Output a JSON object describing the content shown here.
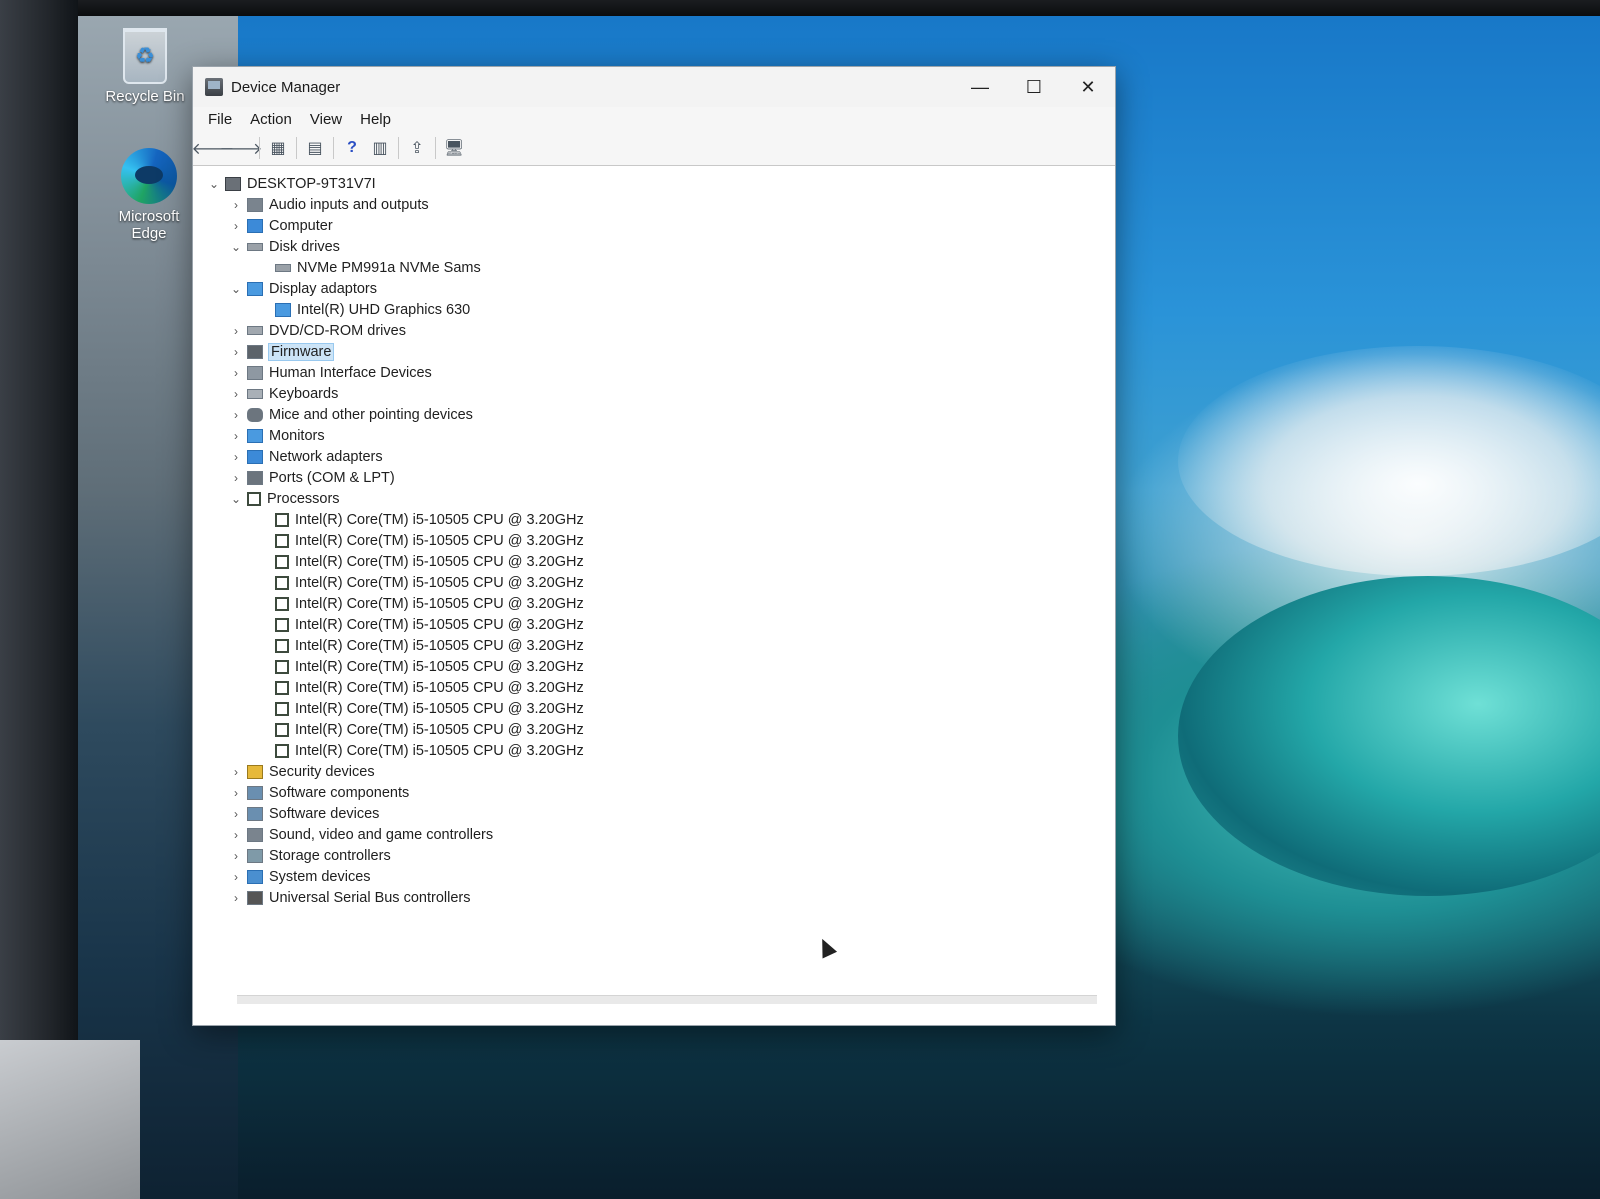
{
  "desktop": {
    "icons": [
      {
        "label": "Recycle Bin"
      },
      {
        "label": "Microsoft Edge"
      }
    ]
  },
  "window": {
    "title": "Device Manager",
    "controls": {
      "minimize": "—",
      "maximize": "☐",
      "close": "✕"
    },
    "menu": [
      "File",
      "Action",
      "View",
      "Help"
    ],
    "toolbar": {
      "back": "🡐",
      "forward": "🡒",
      "t1": "▦",
      "t2": "▤",
      "help": "?",
      "t3": "▥",
      "t4": "⇪",
      "t5": "🖥"
    }
  },
  "tree": {
    "root": "DESKTOP-9T31V7I",
    "categories": [
      {
        "label": "Audio inputs and outputs",
        "icon": "speaker-icon"
      },
      {
        "label": "Computer",
        "icon": "computer-icon"
      },
      {
        "label": "Disk drives",
        "icon": "disk-icon",
        "children": [
          "NVMe PM991a NVMe Sams"
        ]
      },
      {
        "label": "Display adaptors",
        "icon": "display-adapter-icon",
        "children": [
          "Intel(R) UHD Graphics 630"
        ]
      },
      {
        "label": "DVD/CD-ROM drives",
        "icon": "dvd-icon"
      },
      {
        "label": "Firmware",
        "icon": "firmware-icon",
        "selected": true
      },
      {
        "label": "Human Interface Devices",
        "icon": "hid-icon"
      },
      {
        "label": "Keyboards",
        "icon": "keyboard-icon"
      },
      {
        "label": "Mice and other pointing devices",
        "icon": "mouse-icon"
      },
      {
        "label": "Monitors",
        "icon": "monitor-icon"
      },
      {
        "label": "Network adapters",
        "icon": "network-icon"
      },
      {
        "label": "Ports (COM & LPT)",
        "icon": "port-icon"
      },
      {
        "label": "Processors",
        "icon": "processor-icon",
        "children": [
          "Intel(R) Core(TM) i5-10505 CPU @ 3.20GHz",
          "Intel(R) Core(TM) i5-10505 CPU @ 3.20GHz",
          "Intel(R) Core(TM) i5-10505 CPU @ 3.20GHz",
          "Intel(R) Core(TM) i5-10505 CPU @ 3.20GHz",
          "Intel(R) Core(TM) i5-10505 CPU @ 3.20GHz",
          "Intel(R) Core(TM) i5-10505 CPU @ 3.20GHz",
          "Intel(R) Core(TM) i5-10505 CPU @ 3.20GHz",
          "Intel(R) Core(TM) i5-10505 CPU @ 3.20GHz",
          "Intel(R) Core(TM) i5-10505 CPU @ 3.20GHz",
          "Intel(R) Core(TM) i5-10505 CPU @ 3.20GHz",
          "Intel(R) Core(TM) i5-10505 CPU @ 3.20GHz",
          "Intel(R) Core(TM) i5-10505 CPU @ 3.20GHz"
        ]
      },
      {
        "label": "Security devices",
        "icon": "security-icon"
      },
      {
        "label": "Software components",
        "icon": "software-component-icon"
      },
      {
        "label": "Software devices",
        "icon": "software-device-icon"
      },
      {
        "label": "Sound, video and game controllers",
        "icon": "sound-icon"
      },
      {
        "label": "Storage controllers",
        "icon": "storage-icon"
      },
      {
        "label": "System devices",
        "icon": "system-icon"
      },
      {
        "label": "Universal Serial Bus controllers",
        "icon": "usb-icon"
      }
    ]
  },
  "colors": {
    "selection": "#cce4f7",
    "accent": "#3c8ad8"
  }
}
